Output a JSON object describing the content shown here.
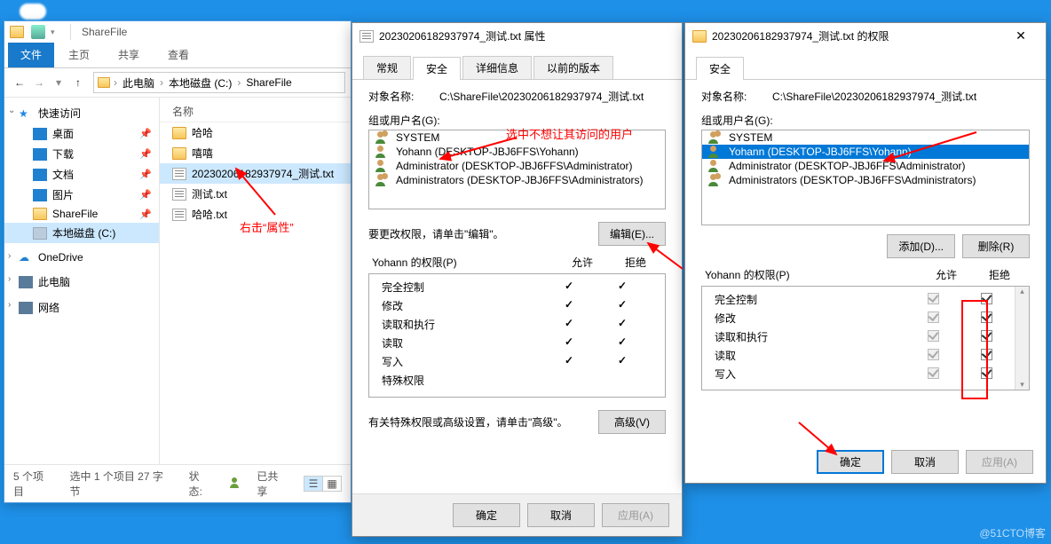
{
  "explorer": {
    "title": "ShareFile",
    "tabs": {
      "file": "文件",
      "home": "主页",
      "share": "共享",
      "view": "查看"
    },
    "breadcrumb": [
      "此电脑",
      "本地磁盘 (C:)",
      "ShareFile"
    ],
    "col_header": "名称",
    "nav": {
      "quick": "快速访问",
      "desktop": "桌面",
      "downloads": "下载",
      "documents": "文档",
      "pictures": "图片",
      "sharefile": "ShareFile",
      "cdrive": "本地磁盘 (C:)",
      "onedrive": "OneDrive",
      "thispc": "此电脑",
      "network": "网络"
    },
    "files": {
      "f0": "哈哈",
      "f1": "嘻嘻",
      "f2": "20230206182937974_测试.txt",
      "f3": "测试.txt",
      "f4": "哈哈.txt"
    },
    "status": {
      "items": "5 个项目",
      "selected": "选中 1 个项目 27 字节",
      "state_label": "状态:",
      "state_value": "已共享"
    }
  },
  "props": {
    "title": "20230206182937974_测试.txt 属性",
    "tabs": {
      "general": "常规",
      "security": "安全",
      "details": "详细信息",
      "prev": "以前的版本"
    },
    "object_label": "对象名称:",
    "object_value": "C:\\ShareFile\\20230206182937974_测试.txt",
    "group_label": "组或用户名(G):",
    "users": {
      "u0": "SYSTEM",
      "u1": "Yohann (DESKTOP-JBJ6FFS\\Yohann)",
      "u2": "Administrator (DESKTOP-JBJ6FFS\\Administrator)",
      "u3": "Administrators (DESKTOP-JBJ6FFS\\Administrators)"
    },
    "edit_hint": "要更改权限，请单击\"编辑\"。",
    "edit_btn": "编辑(E)...",
    "perm_label": "Yohann 的权限(P)",
    "col_allow": "允许",
    "col_deny": "拒绝",
    "perms": {
      "p0": "完全控制",
      "p1": "修改",
      "p2": "读取和执行",
      "p3": "读取",
      "p4": "写入",
      "p5": "特殊权限"
    },
    "adv_hint": "有关特殊权限或高级设置，请单击\"高级\"。",
    "adv_btn": "高级(V)",
    "ok": "确定",
    "cancel": "取消",
    "apply": "应用(A)"
  },
  "perms_dlg": {
    "title": "20230206182937974_测试.txt 的权限",
    "security_tab": "安全",
    "object_label": "对象名称:",
    "object_value": "C:\\ShareFile\\20230206182937974_测试.txt",
    "group_label": "组或用户名(G):",
    "users": {
      "u0": "SYSTEM",
      "u1": "Yohann (DESKTOP-JBJ6FFS\\Yohann)",
      "u2": "Administrator (DESKTOP-JBJ6FFS\\Administrator)",
      "u3": "Administrators (DESKTOP-JBJ6FFS\\Administrators)"
    },
    "add_btn": "添加(D)...",
    "remove_btn": "删除(R)",
    "perm_label": "Yohann 的权限(P)",
    "col_allow": "允许",
    "col_deny": "拒绝",
    "perms": {
      "p0": "完全控制",
      "p1": "修改",
      "p2": "读取和执行",
      "p3": "读取",
      "p4": "写入"
    },
    "ok": "确定",
    "cancel": "取消",
    "apply": "应用(A)"
  },
  "annotations": {
    "a0": "右击“属性”",
    "a1": "选中不想让其访问的用户"
  },
  "watermark": "@51CTO博客"
}
